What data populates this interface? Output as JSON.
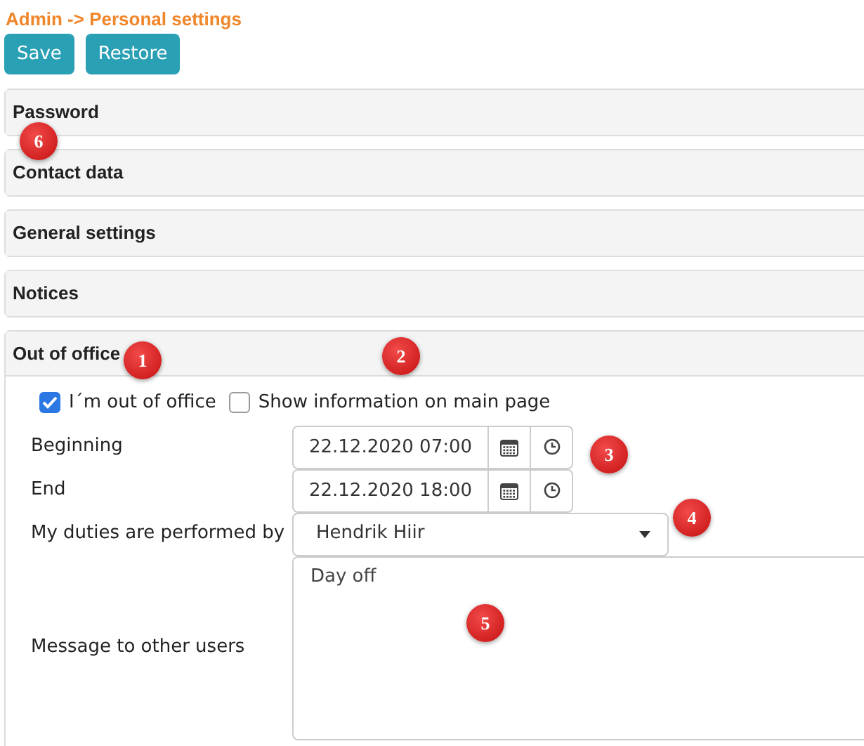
{
  "breadcrumb": "Admin -> Personal settings",
  "buttons": [
    "Save",
    "Restore"
  ],
  "panels": [
    {
      "title": "Password",
      "expanded": false
    },
    {
      "title": "Contact data",
      "expanded": false
    },
    {
      "title": "General settings",
      "expanded": false
    },
    {
      "title": "Notices",
      "expanded": false
    },
    {
      "title": "Out of office",
      "expanded": true
    }
  ],
  "out_of_office": {
    "checkboxes": [
      {
        "label": "I´m out of office",
        "checked": true
      },
      {
        "label": "Show information on main page",
        "checked": false
      }
    ],
    "fields": [
      {
        "kind": "datetime",
        "label": "Beginning",
        "value": "22.12.2020 07:00"
      },
      {
        "kind": "datetime",
        "label": "End",
        "value": "22.12.2020 18:00"
      },
      {
        "kind": "select",
        "label": "My duties are performed by",
        "value": "Hendrik Hiir"
      },
      {
        "kind": "textarea",
        "label": "Message to other users",
        "value": "Day off"
      }
    ]
  },
  "callouts": [
    "1",
    "2",
    "3",
    "4",
    "5",
    "6"
  ]
}
